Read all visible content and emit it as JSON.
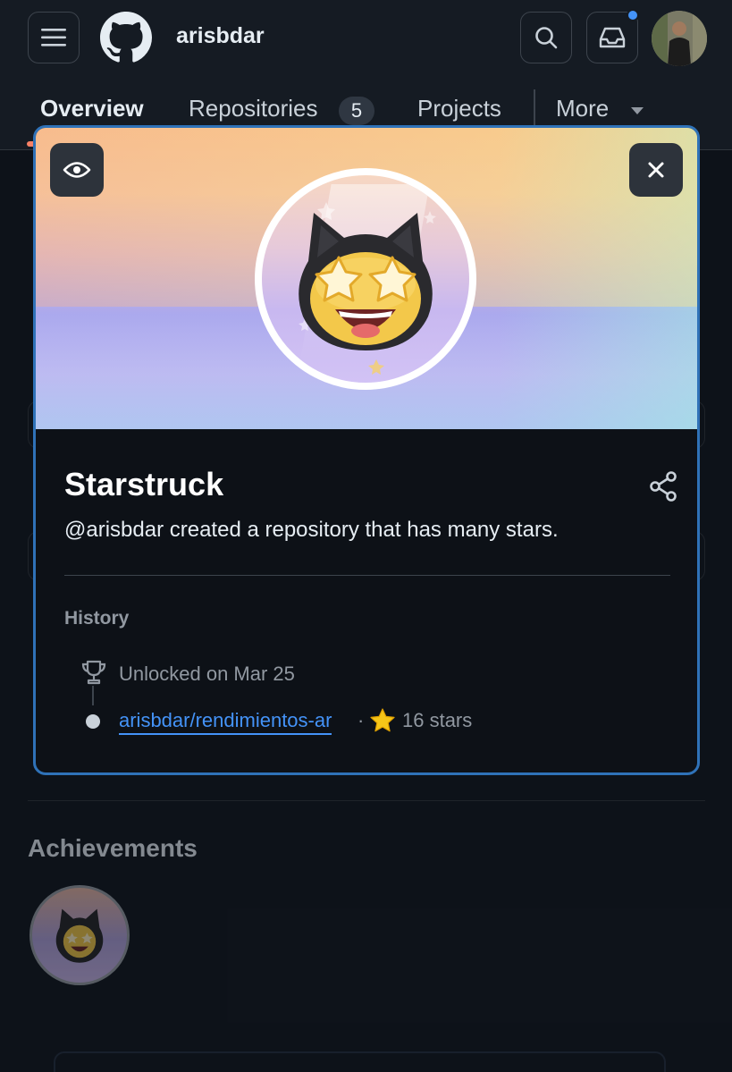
{
  "header": {
    "username": "arisbdar",
    "has_unread_notifications": true,
    "icons": [
      "menu-icon",
      "github-logo-icon",
      "search-icon",
      "inbox-icon",
      "user-avatar"
    ]
  },
  "tabs": {
    "overview": "Overview",
    "repositories": "Repositories",
    "repositories_count": "5",
    "projects": "Projects",
    "more": "More",
    "active": "Overview"
  },
  "background": {
    "achievements_title": "Achievements"
  },
  "achievement_modal": {
    "title": "Starstruck",
    "description": "@arisbdar created a repository that has many stars.",
    "history_label": "History",
    "unlocked_text": "Unlocked on Mar 25",
    "repo_link": "arisbdar/rendimientos-ar",
    "separator": "·",
    "stars_text": "16 stars",
    "icons": [
      "eye-icon",
      "close-icon",
      "share-icon",
      "trophy-icon",
      "star-emoji-icon"
    ]
  },
  "colors": {
    "background": "#151b23",
    "modal_border": "#2f72b8",
    "link": "#4493f8",
    "tab_underline": "#f78166",
    "notification_dot": "#4493f8"
  }
}
